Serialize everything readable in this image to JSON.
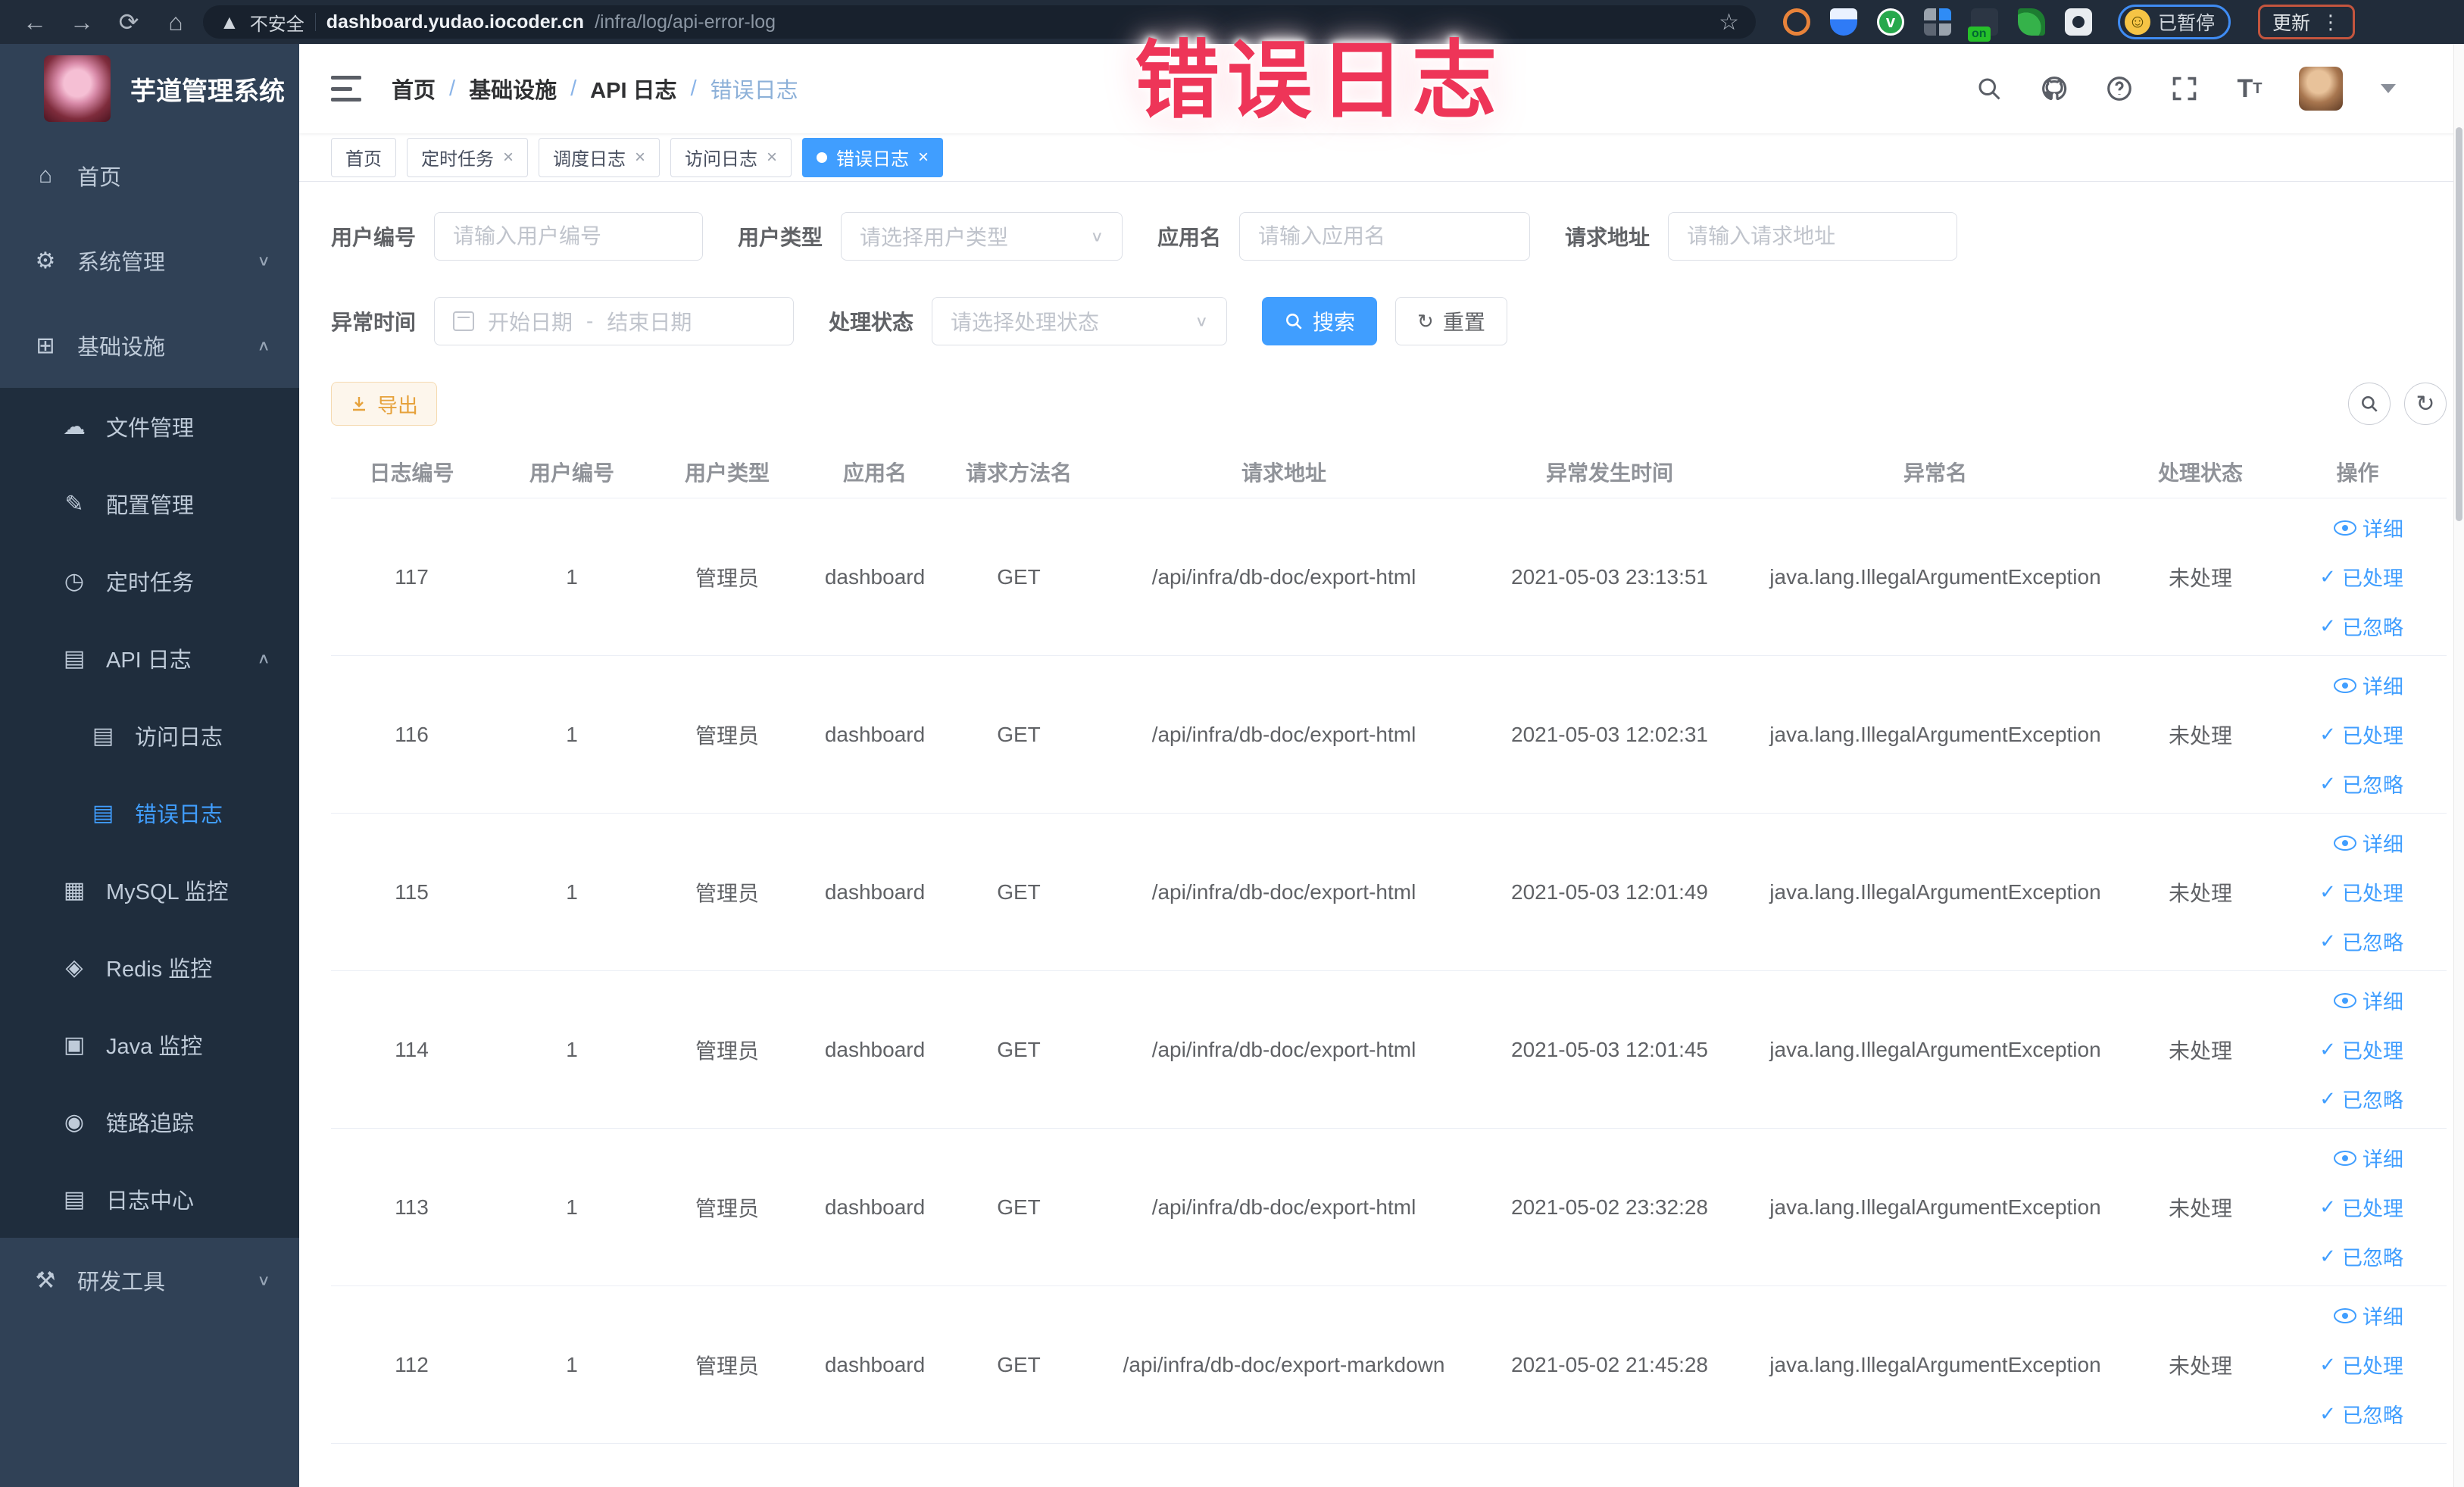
{
  "browser": {
    "security_label": "不安全",
    "url_host": "dashboard.yudao.iocoder.cn",
    "url_path": "/infra/log/api-error-log",
    "paused_badge": "已暂停",
    "update_button": "更新"
  },
  "overlay": {
    "title": "错误日志",
    "color": "#ee3558"
  },
  "sidebar": {
    "title": "芋道管理系统",
    "menu": [
      {
        "label": "首页",
        "icon": "home-icon",
        "level": 1,
        "section": "root"
      },
      {
        "label": "系统管理",
        "icon": "gear-icon",
        "level": 1,
        "section": "root",
        "arrow": "down"
      },
      {
        "label": "基础设施",
        "icon": "infrastructure-icon",
        "level": 1,
        "section": "root",
        "arrow": "up"
      },
      {
        "label": "文件管理",
        "icon": "file-manage-icon",
        "level": 2,
        "section": "sub"
      },
      {
        "label": "配置管理",
        "icon": "config-manage-icon",
        "level": 2,
        "section": "sub"
      },
      {
        "label": "定时任务",
        "icon": "scheduled-job-icon",
        "level": 2,
        "section": "sub"
      },
      {
        "label": "API 日志",
        "icon": "api-log-icon",
        "level": 2,
        "section": "sub",
        "arrow": "up"
      },
      {
        "label": "访问日志",
        "icon": "access-log-icon",
        "level": 3,
        "section": "sub"
      },
      {
        "label": "错误日志",
        "icon": "error-log-icon",
        "level": 3,
        "section": "sub",
        "active": true
      },
      {
        "label": "MySQL 监控",
        "icon": "mysql-monitor-icon",
        "level": 2,
        "section": "sub"
      },
      {
        "label": "Redis 监控",
        "icon": "redis-monitor-icon",
        "level": 2,
        "section": "sub"
      },
      {
        "label": "Java 监控",
        "icon": "java-monitor-icon",
        "level": 2,
        "section": "sub"
      },
      {
        "label": "链路追踪",
        "icon": "tracing-icon",
        "level": 2,
        "section": "sub"
      },
      {
        "label": "日志中心",
        "icon": "log-center-icon",
        "level": 2,
        "section": "sub"
      },
      {
        "label": "研发工具",
        "icon": "dev-tools-icon",
        "level": 1,
        "section": "root",
        "arrow": "down"
      }
    ]
  },
  "navbar": {
    "breadcrumbs": [
      "首页",
      "基础设施",
      "API 日志",
      "错误日志"
    ],
    "separator": "/"
  },
  "tabs": [
    {
      "label": "首页",
      "closable": false,
      "active": false
    },
    {
      "label": "定时任务",
      "closable": true,
      "active": false
    },
    {
      "label": "调度日志",
      "closable": true,
      "active": false
    },
    {
      "label": "访问日志",
      "closable": true,
      "active": false
    },
    {
      "label": "错误日志",
      "closable": true,
      "active": true
    }
  ],
  "filters": {
    "user_id": {
      "label": "用户编号",
      "placeholder": "请输入用户编号"
    },
    "user_type": {
      "label": "用户类型",
      "placeholder": "请选择用户类型"
    },
    "app_name": {
      "label": "应用名",
      "placeholder": "请输入应用名"
    },
    "request_url": {
      "label": "请求地址",
      "placeholder": "请输入请求地址"
    },
    "exception_time": {
      "label": "异常时间",
      "start_placeholder": "开始日期",
      "range_separator": "-",
      "end_placeholder": "结束日期"
    },
    "process_status": {
      "label": "处理状态",
      "placeholder": "请选择处理状态"
    },
    "search_button": "搜索",
    "reset_button": "重置"
  },
  "toolbar": {
    "export_button": "导出"
  },
  "table": {
    "headers": [
      "日志编号",
      "用户编号",
      "用户类型",
      "应用名",
      "请求方法名",
      "请求地址",
      "异常发生时间",
      "异常名",
      "处理状态",
      "操作"
    ],
    "actions": [
      "详细",
      "已处理",
      "已忽略"
    ],
    "rows": [
      {
        "id": "117",
        "user_id": "1",
        "user_type": "管理员",
        "app": "dashboard",
        "method": "GET",
        "url": "/api/infra/db-doc/export-html",
        "time": "2021-05-03 23:13:51",
        "exception": "java.lang.IllegalArgumentException",
        "status": "未处理"
      },
      {
        "id": "116",
        "user_id": "1",
        "user_type": "管理员",
        "app": "dashboard",
        "method": "GET",
        "url": "/api/infra/db-doc/export-html",
        "time": "2021-05-03 12:02:31",
        "exception": "java.lang.IllegalArgumentException",
        "status": "未处理"
      },
      {
        "id": "115",
        "user_id": "1",
        "user_type": "管理员",
        "app": "dashboard",
        "method": "GET",
        "url": "/api/infra/db-doc/export-html",
        "time": "2021-05-03 12:01:49",
        "exception": "java.lang.IllegalArgumentException",
        "status": "未处理"
      },
      {
        "id": "114",
        "user_id": "1",
        "user_type": "管理员",
        "app": "dashboard",
        "method": "GET",
        "url": "/api/infra/db-doc/export-html",
        "time": "2021-05-03 12:01:45",
        "exception": "java.lang.IllegalArgumentException",
        "status": "未处理"
      },
      {
        "id": "113",
        "user_id": "1",
        "user_type": "管理员",
        "app": "dashboard",
        "method": "GET",
        "url": "/api/infra/db-doc/export-html",
        "time": "2021-05-02 23:32:28",
        "exception": "java.lang.IllegalArgumentException",
        "status": "未处理"
      },
      {
        "id": "112",
        "user_id": "1",
        "user_type": "管理员",
        "app": "dashboard",
        "method": "GET",
        "url": "/api/infra/db-doc/export-markdown",
        "time": "2021-05-02 21:45:28",
        "exception": "java.lang.IllegalArgumentException",
        "status": "未处理"
      }
    ]
  },
  "colors": {
    "accent": "#409eff",
    "sidebar_bg": "#304156",
    "submenu_bg": "#1f2d3d",
    "sidebar_text": "#bfcbd9",
    "warning_text": "#e6a23c",
    "warning_bg": "#fdf6ec",
    "overlay_pink": "#ee3558"
  }
}
